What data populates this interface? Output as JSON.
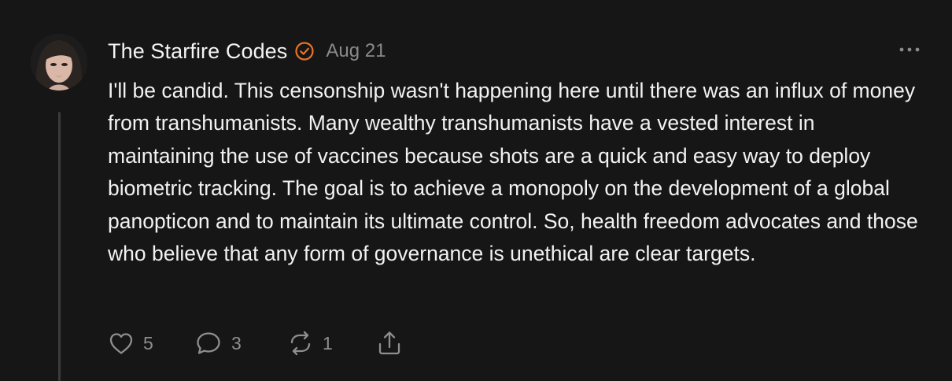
{
  "post": {
    "author": "The Starfire Codes",
    "date": "Aug 21",
    "verified_icon": "verified-check-icon",
    "more_icon": "more-horizontal-icon",
    "text": "I'll be candid. This censonship wasn't happening here until there was an influx of money from transhumanists. Many wealthy transhumanists have a vested interest in maintaining the use of vaccines because shots are a quick and easy way to deploy biometric tracking. The goal is to achieve a monopoly on the development of a global panopticon and to maintain its ultimate control. So, health freedom advocates and those who believe that any form of governance is unethical are clear targets.",
    "actions": {
      "likes": "5",
      "comments": "3",
      "restacks": "1"
    }
  },
  "colors": {
    "background": "#161616",
    "text": "#f2f2f2",
    "muted": "#8e8e8e",
    "accent": "#e8732a",
    "thread_line": "#3b3b3b"
  }
}
